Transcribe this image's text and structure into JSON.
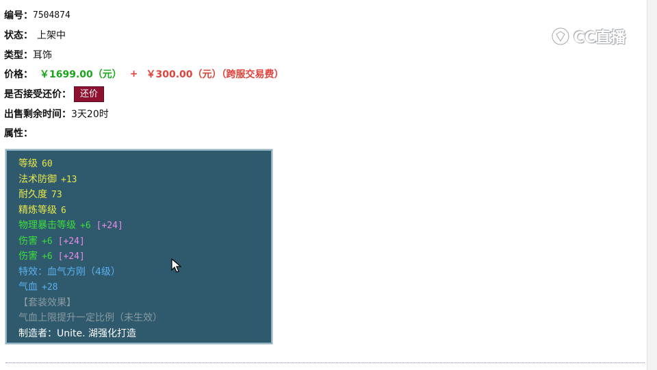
{
  "item": {
    "id_label": "编号：",
    "id_value": "7504874",
    "status_label": "状态：",
    "status_value": "上架中",
    "type_label": "类型：",
    "type_value": "耳饰",
    "price_label": "价格：",
    "price_main": "￥1699.00（元）",
    "price_plus": "+",
    "price_fee": "￥300.00（元）（跨服交易费）",
    "counter_label": "是否接受还价：",
    "counter_button": "还价",
    "time_label": "出售剩余时间：",
    "time_value": "3天20时",
    "attr_label": "属性："
  },
  "attributes": [
    {
      "text": "等级",
      "value": "60",
      "color": "#e8e84a"
    },
    {
      "text": "法术防御",
      "value": "+13",
      "color": "#e8e84a"
    },
    {
      "text": "耐久度",
      "value": "73",
      "color": "#e8e84a"
    },
    {
      "text": "精炼等级",
      "value": "6",
      "color": "#e8e84a"
    },
    {
      "text": "物理暴击等级",
      "value": "+6",
      "extra": "[+24]",
      "color": "#3ddc3d",
      "extra_color": "#e88ae8"
    },
    {
      "text": "伤害",
      "value": "+6",
      "extra": "[+24]",
      "color": "#3ddc3d",
      "extra_color": "#e88ae8"
    },
    {
      "text": "伤害",
      "value": "+6",
      "extra": "[+24]",
      "color": "#3ddc3d",
      "extra_color": "#e88ae8"
    },
    {
      "text": "特效：血气方刚（4级）",
      "value": "",
      "color": "#5ab0f0"
    },
    {
      "text": "气血",
      "value": "+28",
      "color": "#5ab0f0"
    },
    {
      "text": "【套装效果】",
      "value": "",
      "color": "#8a9aa0"
    },
    {
      "text": "气血上限提升一定比例（未生效）",
      "value": "",
      "color": "#8a9aa0"
    },
    {
      "text": "制造者：Unite. 湖强化打造",
      "value": "",
      "color": "#ffffff"
    }
  ],
  "watermark": {
    "text": "CC直播",
    "icon": "cc-live-logo-icon"
  },
  "colors": {
    "attr_bg": "#2f5a6d",
    "price_green": "#1aa51a",
    "price_red": "#e0423a",
    "button_bg": "#8e1130"
  }
}
